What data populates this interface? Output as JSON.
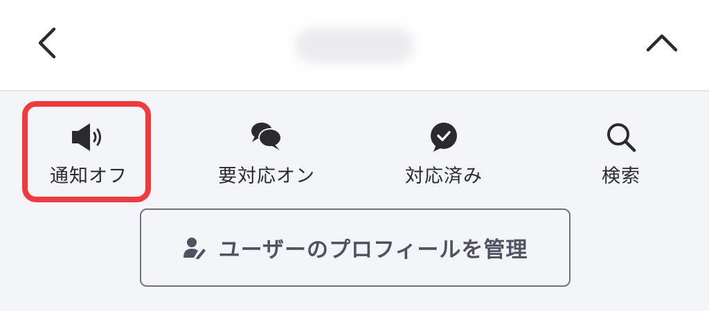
{
  "header": {
    "back_icon": "chevron-left-icon",
    "collapse_icon": "chevron-up-icon"
  },
  "actions": [
    {
      "label": "通知オフ",
      "icon": "speaker-icon"
    },
    {
      "label": "要対応オン",
      "icon": "speech-bubbles-icon"
    },
    {
      "label": "対応済み",
      "icon": "check-bubble-icon"
    },
    {
      "label": "検索",
      "icon": "search-icon"
    }
  ],
  "profile_button": {
    "label": "ユーザーのプロフィールを管理",
    "icon": "user-edit-icon"
  },
  "colors": {
    "highlight": "#f23a3c",
    "icon": "#2b2b2d",
    "button_text": "#4f5263",
    "background": "#f4f5f8"
  }
}
